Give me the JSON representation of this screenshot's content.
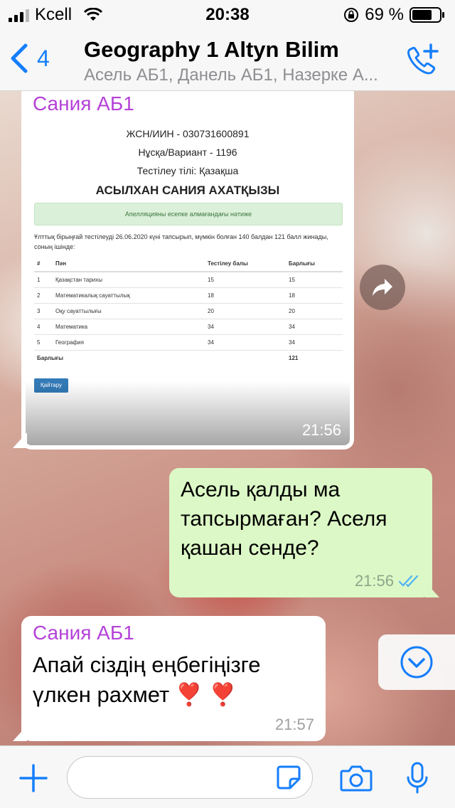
{
  "status_bar": {
    "carrier": "Kcell",
    "time": "20:38",
    "battery": "69 %"
  },
  "header": {
    "back_count": "4",
    "title": "Geography 1 Altyn Bilim",
    "subtitle": "Асель АБ1, Данель АБ1, Назерке А..."
  },
  "messages": [
    {
      "sender": "Сания АБ1",
      "time": "21:56",
      "attachment": {
        "id_line": "ЖСН/ИИН - 030731600891",
        "variant_line": "Нұсқа/Вариант - 1196",
        "language_line": "Тестілеу тілі: Қазақша",
        "student_name": "АСЫЛХАН САНИЯ АХАТҚЫЗЫ",
        "alert": "Апелляцияны есепке алмағандағы нәтиже",
        "intro": "Ұлттық бірыңғай тестілеуді 26.06.2020 күні тапсырып, мүмкін болған 140 балдан 121 балл жинады, соның ішінде:",
        "table": {
          "headers": [
            "#",
            "Пән",
            "Тестілеу балы",
            "Барлығы"
          ],
          "rows": [
            [
              "1",
              "Қазақстан тарихы",
              "15",
              "15"
            ],
            [
              "2",
              "Математикалық сауаттылық",
              "18",
              "18"
            ],
            [
              "3",
              "Оқу сауаттылығы",
              "20",
              "20"
            ],
            [
              "4",
              "Математика",
              "34",
              "34"
            ],
            [
              "5",
              "География",
              "34",
              "34"
            ]
          ],
          "total_label": "Барлығы",
          "total_value": "121"
        },
        "button": "Қайтару"
      }
    },
    {
      "direction": "out",
      "text": "Асель қалды ма тапсырмаған? Аселя қашан сенде?",
      "time": "21:56",
      "status_icon": "double-check-read"
    },
    {
      "sender": "Сания АБ1",
      "text": "Апай сіздің еңбегіңізге үлкен рахмет ❣️ ❣️",
      "time": "21:57"
    }
  ],
  "input": {
    "value": "",
    "placeholder": ""
  },
  "colors": {
    "accent": "#157efb",
    "sender_name": "#b542d8",
    "outgoing_bubble": "#dcf8c6",
    "read_check": "#4fb3f6"
  }
}
